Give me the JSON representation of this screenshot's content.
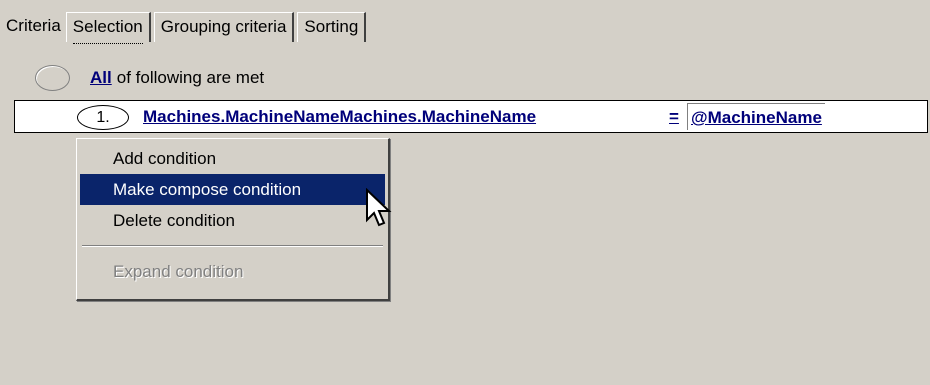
{
  "tabs": [
    {
      "label": "Criteria",
      "active": true
    },
    {
      "label": "Selection",
      "active": false
    },
    {
      "label": "Grouping criteria",
      "active": false
    },
    {
      "label": "Sorting",
      "active": false
    }
  ],
  "root_condition": {
    "quantifier": "All",
    "text": "of following are met"
  },
  "condition": {
    "number": "1.",
    "field": "Machines.MachineNameMachines.MachineName",
    "operator": "=",
    "value": "@MachineName"
  },
  "context_menu": {
    "items": [
      {
        "label": "Add condition",
        "state": "normal"
      },
      {
        "label": "Make compose condition",
        "state": "highlighted"
      },
      {
        "label": "Delete condition",
        "state": "normal"
      },
      {
        "label": "Expand condition",
        "state": "disabled"
      }
    ]
  },
  "colors": {
    "background": "#d4d0c8",
    "link": "#00007a",
    "menu_highlight": "#0a246a",
    "disabled_text": "#808080"
  },
  "icons": {
    "cursor": "mouse-pointer-icon"
  }
}
